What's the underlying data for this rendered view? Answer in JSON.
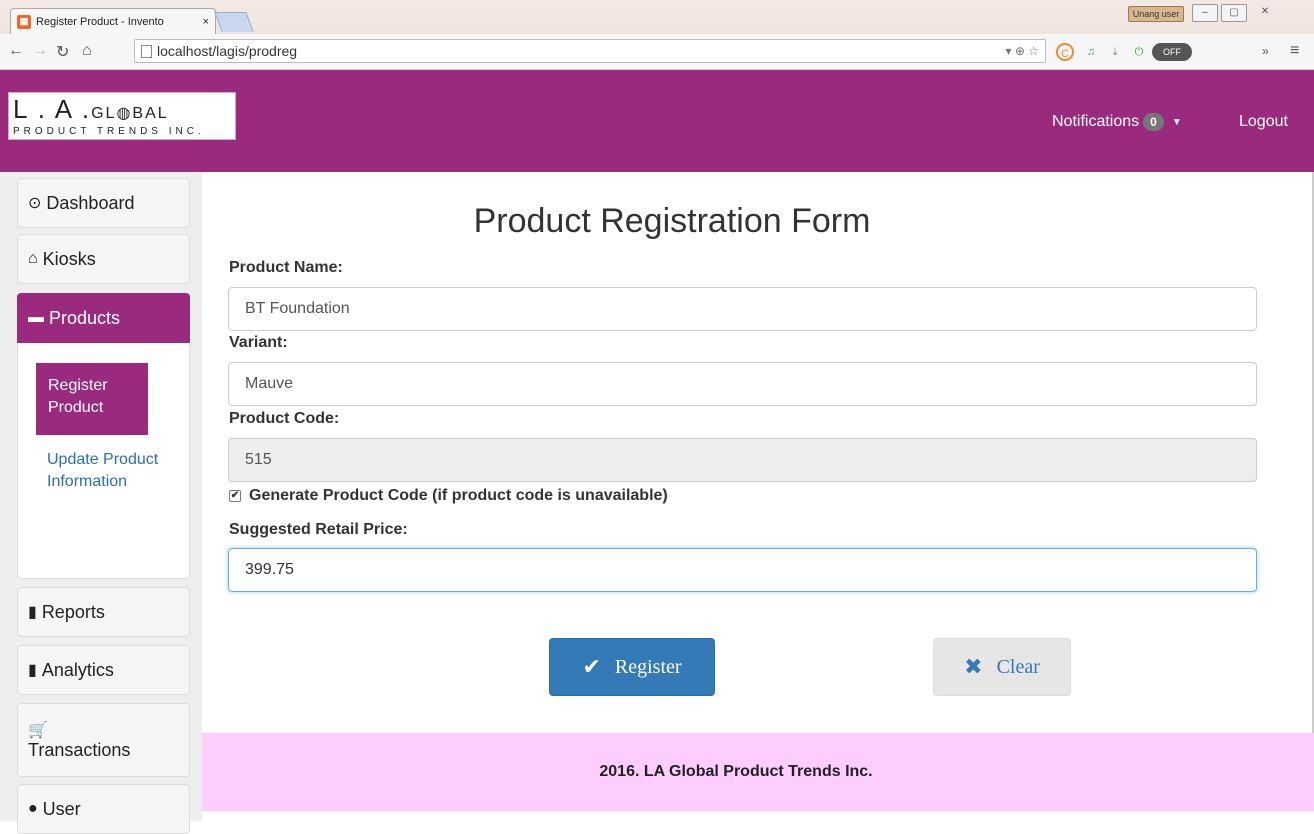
{
  "browser": {
    "tab_title": "Register Product - Invento",
    "tab_close": "×",
    "user_label": "Unang user",
    "url": "localhost/lagis/prodreg",
    "ext_toggle": "OFF"
  },
  "header": {
    "logo_main_1": "L . A .",
    "logo_main_2": "GL",
    "logo_main_3": "BAL",
    "logo_sub": "PRODUCT TRENDS INC.",
    "notifications_label": "Notifications",
    "notifications_count": "0",
    "logout_label": "Logout",
    "brand_color": "#9a2a7e"
  },
  "sidebar": {
    "items": [
      {
        "label": "Dashboard",
        "icon": "dashboard-icon"
      },
      {
        "label": "Kiosks",
        "icon": "home-icon"
      },
      {
        "label": "Products",
        "icon": "briefcase-icon"
      },
      {
        "label": "Reports",
        "icon": "file-icon"
      },
      {
        "label": "Analytics",
        "icon": "bar-chart-icon"
      },
      {
        "label": "Transactions",
        "icon": "cart-icon"
      },
      {
        "label": "User",
        "icon": "user-icon"
      }
    ],
    "sub_items": [
      {
        "label": "Register Product",
        "active": true
      },
      {
        "label": "Update Product Information",
        "active": false
      }
    ]
  },
  "form": {
    "title": "Product Registration Form",
    "product_name_label": "Product Name:",
    "product_name_value": "BT Foundation",
    "variant_label": "Variant:",
    "variant_value": "Mauve",
    "product_code_label": "Product Code:",
    "product_code_value": "515",
    "generate_code_label": "Generate Product Code (if product code is unavailable)",
    "generate_code_checked": true,
    "price_label": "Suggested Retail Price:",
    "price_value": "399.75",
    "register_label": "Register",
    "clear_label": "Clear"
  },
  "footer": {
    "text": "2016. LA Global Product Trends Inc.",
    "bg_color": "#fdcdfd"
  }
}
